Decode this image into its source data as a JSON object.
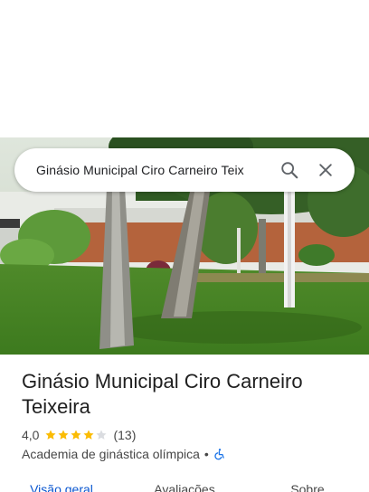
{
  "search": {
    "query": "Ginásio Municipal Ciro Carneiro Teix",
    "search_icon": "search-icon",
    "close_icon": "close-icon"
  },
  "place": {
    "name": "Ginásio Municipal Ciro Carneiro Teixeira",
    "rating": "4,0",
    "stars_filled": 4,
    "stars_total": 5,
    "review_count": "(13)",
    "category": "Academia de ginástica olímpica",
    "separator": "•",
    "accessibility_icon": "wheelchair-icon"
  },
  "tabs": [
    {
      "label": "Visão geral",
      "active": true
    },
    {
      "label": "Avaliações",
      "active": false
    },
    {
      "label": "Sobre",
      "active": false
    }
  ],
  "colors": {
    "accent": "#0b57d0",
    "star": "#fbbc04",
    "star_empty": "#dadce0",
    "accessibility": "#1a73e8"
  }
}
